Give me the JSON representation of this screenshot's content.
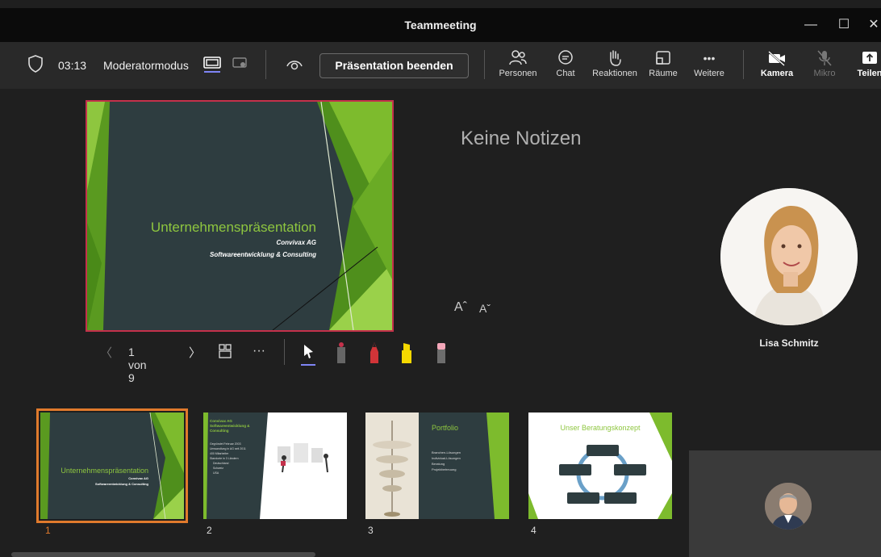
{
  "window": {
    "title": "Teammeeting",
    "minimize": "—",
    "maximize": "☐",
    "close": "✕"
  },
  "toolbar": {
    "timer": "03:13",
    "presenter_mode_label": "Moderatormodus",
    "end_presentation": "Präsentation beenden",
    "items": {
      "people": "Personen",
      "chat": "Chat",
      "reactions": "Reaktionen",
      "rooms": "Räume",
      "more": "Weitere",
      "camera": "Kamera",
      "mic": "Mikro",
      "share": "Teilen"
    },
    "more_glyph": "•••"
  },
  "current_slide": {
    "title": "Unternehmenspräsentation",
    "subtitle1": "Convivax AG",
    "subtitle2": "Softwareentwicklung & Consulting"
  },
  "notes": {
    "text": "Keine Notizen"
  },
  "font_controls": {
    "increase": "Aˆ",
    "decrease": "Aˇ"
  },
  "nav": {
    "prev": "〈",
    "counter": "1 von 9",
    "next": "〉",
    "more": "···"
  },
  "participant": {
    "name": "Lisa Schmitz"
  },
  "thumbnails": [
    {
      "number": "1",
      "title": "Unternehmenspräsentation",
      "sub1": "Convivax AG",
      "sub2": "Softwareentwicklung & Consulting"
    },
    {
      "number": "2",
      "title": "Convivax AG Softwareentwicklung & Consulting",
      "bullets": [
        "Gegründet Februar 2003",
        "Umwandlung in AG seit 2011",
        "400 Mitarbeiter",
        "Standorte in 3 Ländern",
        "Deutschland",
        "Schweiz",
        "USA"
      ]
    },
    {
      "number": "3",
      "title": "Portfolio",
      "bullets": [
        "Branchen-Lösungen",
        "Individual-Lösungen",
        "Beratung",
        "Projektbetreuung"
      ]
    },
    {
      "number": "4",
      "title": "Unser Beratungskonzept"
    }
  ],
  "colors": {
    "accent": "#c4314b",
    "selected": "#e07a2c",
    "slide_bg": "#2e3d40",
    "slide_green": "#7dbb2d",
    "title_green": "#8ec63f"
  }
}
